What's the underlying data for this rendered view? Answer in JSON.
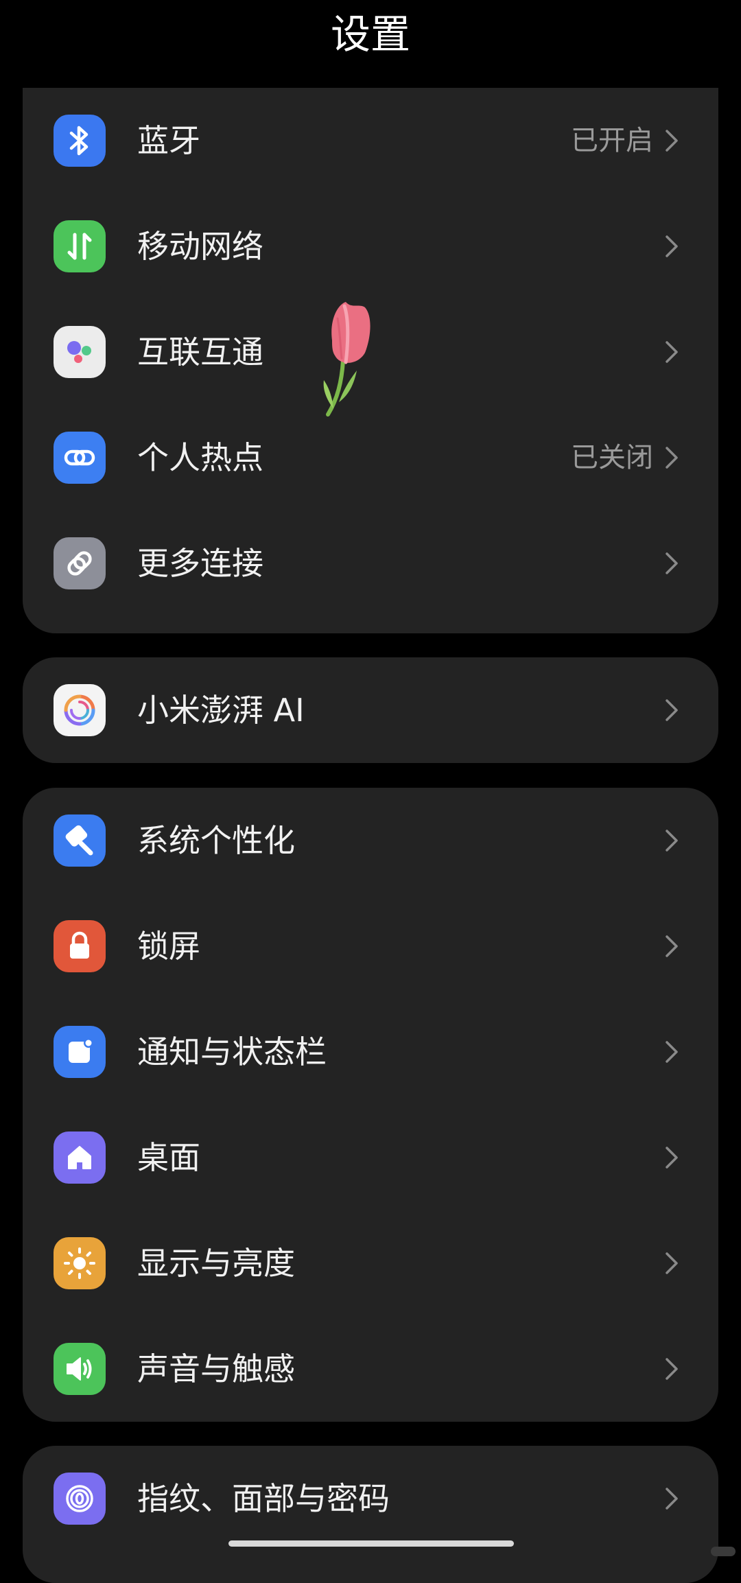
{
  "header": {
    "title": "设置"
  },
  "groups": [
    {
      "rows": [
        {
          "label": "蓝牙",
          "status": "已开启",
          "icon": "bluetooth-icon",
          "color": "#3b78f0"
        },
        {
          "label": "移动网络",
          "status": "",
          "icon": "mobile-data-icon",
          "color": "#4cc45a"
        },
        {
          "label": "互联互通",
          "status": "",
          "icon": "interconnect-icon",
          "color": "#ececec"
        },
        {
          "label": "个人热点",
          "status": "已关闭",
          "icon": "hotspot-link-icon",
          "color": "#3d7ff2"
        },
        {
          "label": "更多连接",
          "status": "",
          "icon": "more-connections-icon",
          "color": "#8d8f99"
        }
      ]
    },
    {
      "rows": [
        {
          "label": "小米澎湃 AI",
          "status": "",
          "icon": "hyper-ai-icon",
          "color": "#f4f4f4"
        }
      ]
    },
    {
      "rows": [
        {
          "label": "系统个性化",
          "status": "",
          "icon": "personalization-icon",
          "color": "#3b7cf0"
        },
        {
          "label": "锁屏",
          "status": "",
          "icon": "lock-icon",
          "color": "#e1573a"
        },
        {
          "label": "通知与状态栏",
          "status": "",
          "icon": "notification-icon",
          "color": "#3b7cf0"
        },
        {
          "label": "桌面",
          "status": "",
          "icon": "home-icon",
          "color": "#7b6ef0"
        },
        {
          "label": "显示与亮度",
          "status": "",
          "icon": "brightness-sun-icon",
          "color": "#e8a33a"
        },
        {
          "label": "声音与触感",
          "status": "",
          "icon": "speaker-icon",
          "color": "#4cc45a"
        }
      ]
    },
    {
      "rows": [
        {
          "label": "指纹、面部与密码",
          "status": "",
          "icon": "fingerprint-icon",
          "color": "#7b6ef0"
        }
      ]
    }
  ]
}
